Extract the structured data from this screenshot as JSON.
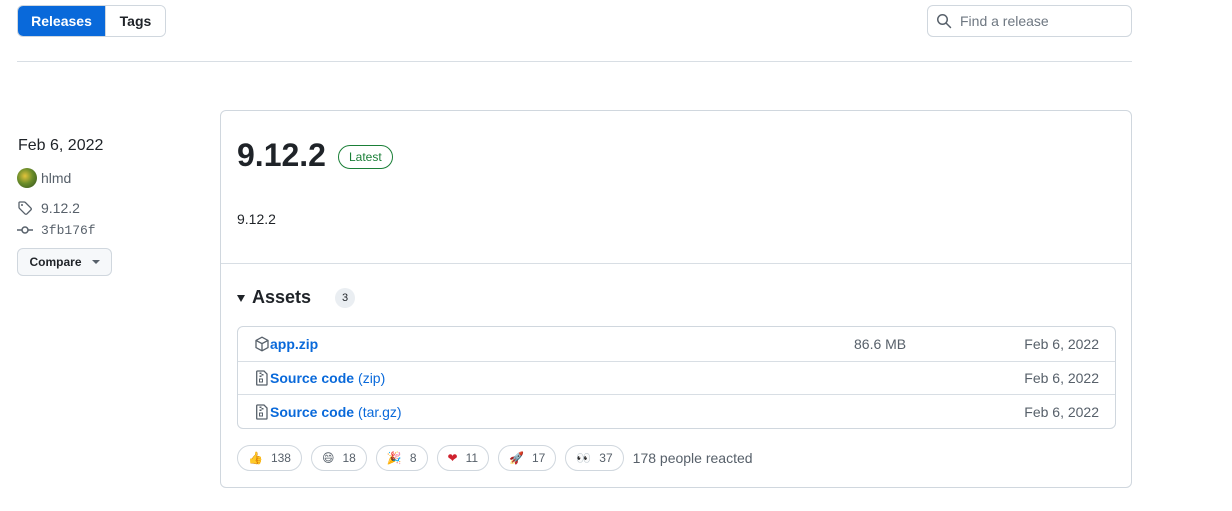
{
  "nav": {
    "releases_label": "Releases",
    "tags_label": "Tags",
    "search_placeholder": "Find a release"
  },
  "meta": {
    "date": "Feb 6, 2022",
    "author": "hlmd",
    "tag": "9.12.2",
    "commit": "3fb176f",
    "compare_label": "Compare"
  },
  "release": {
    "title": "9.12.2",
    "badge": "Latest",
    "body": "9.12.2"
  },
  "assets": {
    "title": "Assets",
    "count": "3",
    "items": [
      {
        "name": "app.zip",
        "suffix": "",
        "size": "86.6 MB",
        "date": "Feb 6, 2022",
        "icon": "package-icon"
      },
      {
        "name": "Source code",
        "suffix": "(zip)",
        "size": "",
        "date": "Feb 6, 2022",
        "icon": "file-zip-icon"
      },
      {
        "name": "Source code",
        "suffix": "(tar.gz)",
        "size": "",
        "date": "Feb 6, 2022",
        "icon": "file-zip-icon"
      }
    ]
  },
  "reactions": {
    "items": [
      {
        "emoji": "👍",
        "name": "thumbs-up",
        "count": "138"
      },
      {
        "emoji": "😄",
        "name": "laugh",
        "count": "18"
      },
      {
        "emoji": "🎉",
        "name": "hooray",
        "count": "8"
      },
      {
        "emoji": "❤",
        "name": "heart",
        "count": "11"
      },
      {
        "emoji": "🚀",
        "name": "rocket",
        "count": "17"
      },
      {
        "emoji": "👀",
        "name": "eyes",
        "count": "37"
      }
    ],
    "summary": "178 people reacted"
  },
  "colors": {
    "accent": "#0969da",
    "latest_green": "#1a7f37",
    "muted": "#57606a",
    "border": "#d0d7de"
  }
}
